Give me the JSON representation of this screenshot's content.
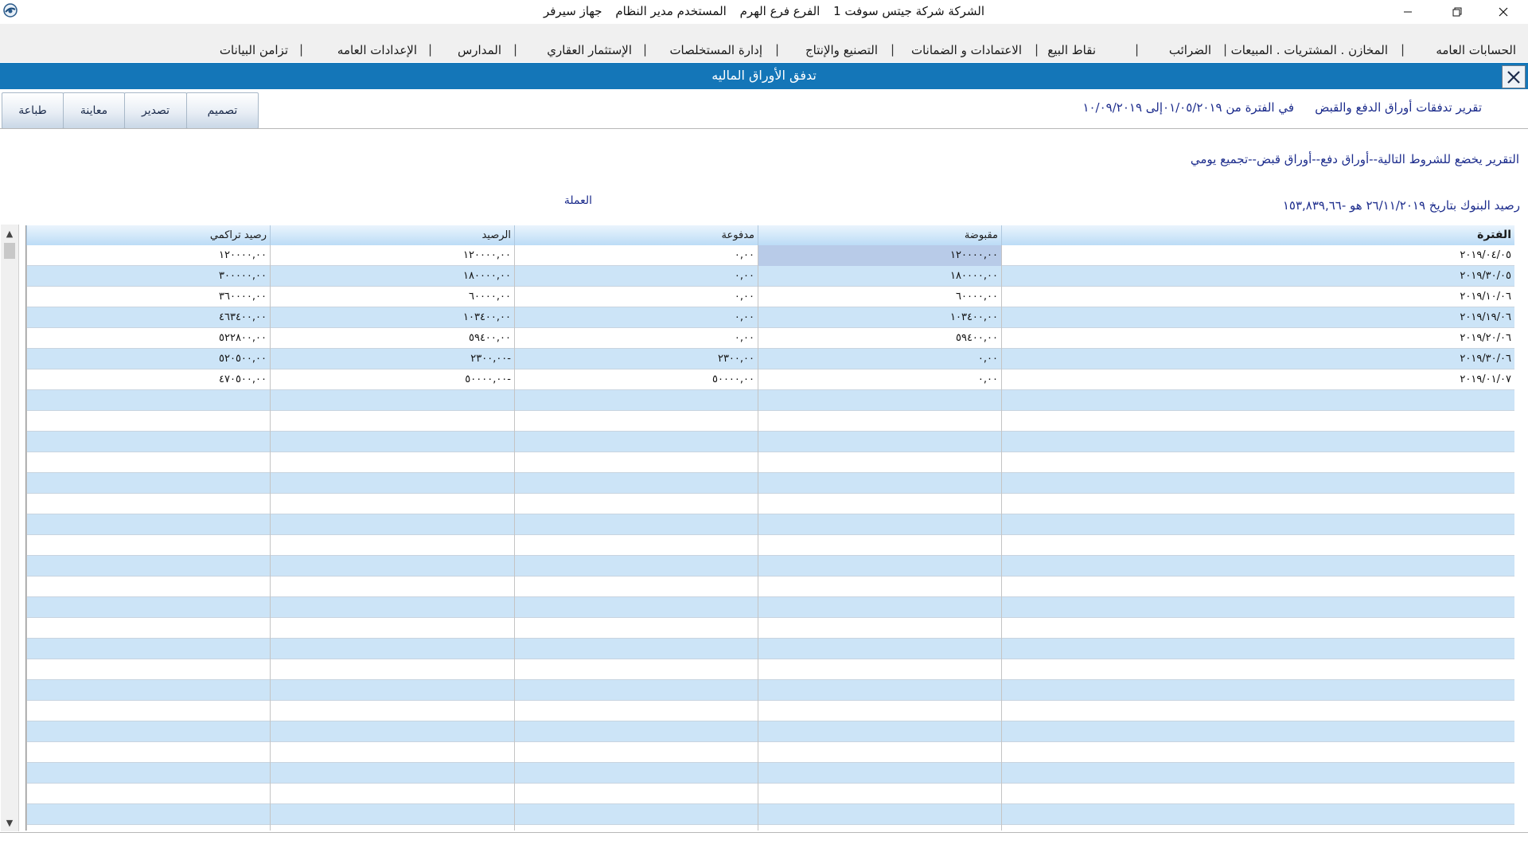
{
  "titlebar": {
    "company": "الشركة شركة جيتس سوفت 1",
    "branch": "الفرع فرع الهرم",
    "user": "المستخدم مدير النظام",
    "device": "جهاز سيرفر"
  },
  "menu": {
    "items": [
      {
        "label": "الحسابات العامه"
      },
      {
        "label": "المخازن . المشتريات . المبيعات"
      },
      {
        "label": "الضرائب"
      },
      {
        "label": "نقاط البيع"
      },
      {
        "label": "الاعتمادات و الضمانات"
      },
      {
        "label": "التصنيع والإنتاج"
      },
      {
        "label": "إدارة المستخلصات"
      },
      {
        "label": "الإستثمار العقاري"
      },
      {
        "label": "المدارس"
      },
      {
        "label": "الإعدادات العامه"
      },
      {
        "label": "تزامن البيانات"
      }
    ],
    "separator": "|"
  },
  "form": {
    "title": "تدفق الأوراق الماليه"
  },
  "toolbar": {
    "design_label": "تصميم",
    "export_label": "تصدير",
    "preview_label": "معاينة",
    "print_label": "طباعة"
  },
  "report": {
    "title": "تقرير تدفقات أوراق الدفع والقبض",
    "period": "في الفترة من ٠١/٠٥/٢٠١٩إلى ١٠/٠٩/٢٠١٩",
    "conditions": "التقرير يخضع للشروط التالية--أوراق دفع--أوراق قبض--تجميع يومي",
    "bank_balance": "رصيد البنوك بتاريخ  ٢٦/١١/٢٠١٩ هو  -١٥٣,٨٣٩,٦٦",
    "currency_label": "العملة"
  },
  "table": {
    "columns": [
      "الفترة",
      "مقبوضة",
      "مدفوعة",
      "الرصيد",
      "رصيد تراكمي"
    ],
    "rows": [
      [
        "٢٠١٩/٠٤/٠٥",
        "١٢٠٠٠٠,٠٠",
        "٠,٠٠",
        "١٢٠٠٠٠,٠٠",
        "١٢٠٠٠٠,٠٠"
      ],
      [
        "٢٠١٩/٣٠/٠٥",
        "١٨٠٠٠٠,٠٠",
        "٠,٠٠",
        "١٨٠٠٠٠,٠٠",
        "٣٠٠٠٠٠,٠٠"
      ],
      [
        "٢٠١٩/١٠/٠٦",
        "٦٠٠٠٠,٠٠",
        "٠,٠٠",
        "٦٠٠٠٠,٠٠",
        "٣٦٠٠٠٠,٠٠"
      ],
      [
        "٢٠١٩/١٩/٠٦",
        "١٠٣٤٠٠,٠٠",
        "٠,٠٠",
        "١٠٣٤٠٠,٠٠",
        "٤٦٣٤٠٠,٠٠"
      ],
      [
        "٢٠١٩/٢٠/٠٦",
        "٥٩٤٠٠,٠٠",
        "٠,٠٠",
        "٥٩٤٠٠,٠٠",
        "٥٢٢٨٠٠,٠٠"
      ],
      [
        "٢٠١٩/٣٠/٠٦",
        "٠,٠٠",
        "٢٣٠٠,٠٠",
        "٢٣٠٠,٠٠-",
        "٥٢٠٥٠٠,٠٠"
      ],
      [
        "٢٠١٩/٠١/٠٧",
        "٠,٠٠",
        "٥٠٠٠٠,٠٠",
        "٥٠٠٠٠,٠٠-",
        "٤٧٠٥٠٠,٠٠"
      ]
    ]
  },
  "colors": {
    "form_header": "#1476b8",
    "row_alt": "#cce4f7",
    "selected_cell": "#b8cbe8",
    "info_text": "#1c2c8c"
  }
}
